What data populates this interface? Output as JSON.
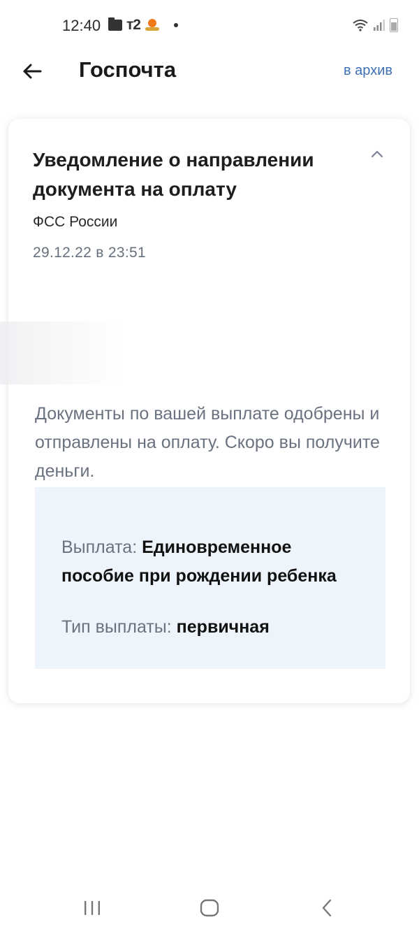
{
  "status_bar": {
    "time": "12:40",
    "carrier": "т2",
    "icons": [
      "folder-icon",
      "sun-icon",
      "dot-icon",
      "wifi-icon",
      "signal-icon",
      "battery-icon"
    ]
  },
  "header": {
    "title": "Госпочта",
    "archive_label": "в архив",
    "back_icon": "arrow-left-icon"
  },
  "notification": {
    "title": "Уведомление о направлении документа на оплату",
    "sender": "ФСС России",
    "date": "29.12.22 в 23:51",
    "message": "Документы по вашей выплате одобрены и отправлены на оплату. Скоро вы получите деньги.",
    "details": {
      "payment_label": "Выплата:",
      "payment_value": "Единовременное пособие при рождении ребенка",
      "type_label": "Тип выплаты:",
      "type_value": "первичная"
    }
  },
  "colors": {
    "accent_link": "#3d6fb6",
    "muted_text": "#6a7280",
    "info_box_bg": "#eef4fb"
  },
  "nav_bar": {
    "icons": [
      "recent-apps-icon",
      "home-icon",
      "back-icon"
    ]
  }
}
